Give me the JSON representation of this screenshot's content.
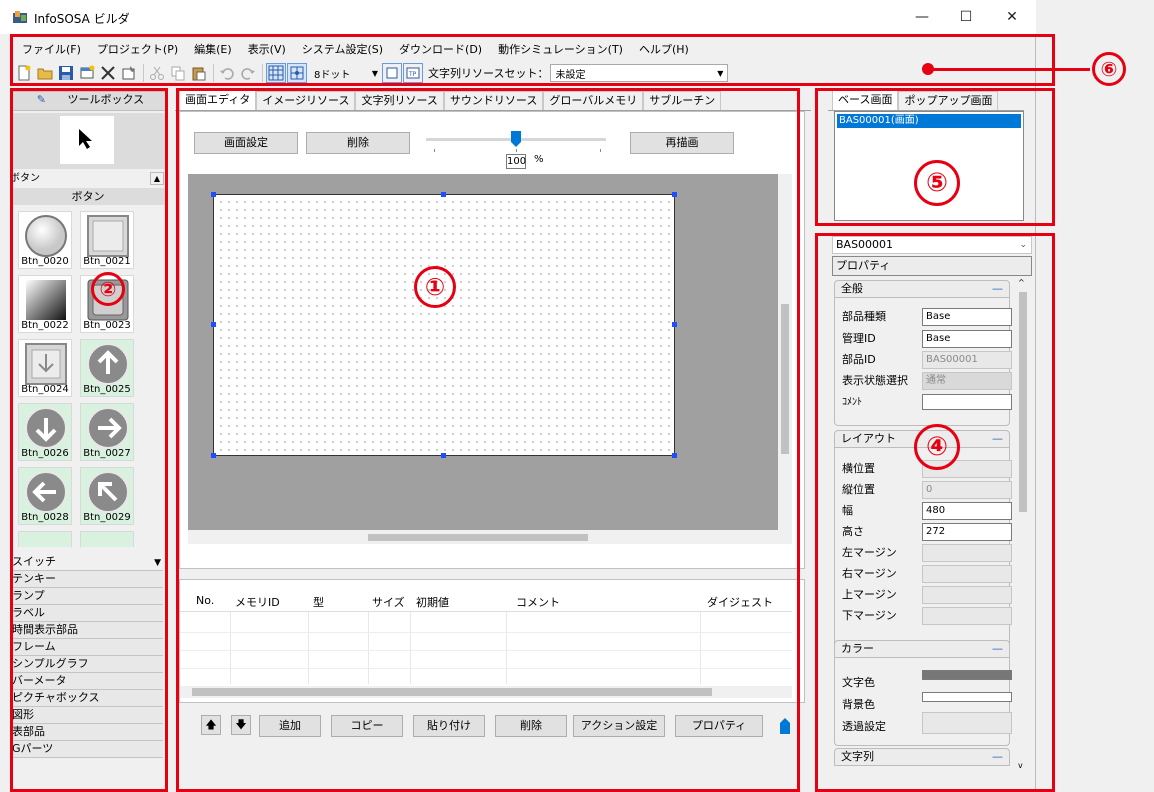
{
  "window": {
    "title": "InfoSOSA ビルダ",
    "minimize": "—",
    "maximize": "☐",
    "close": "✕"
  },
  "menu": [
    "ファイル(F)",
    "プロジェクト(P)",
    "編集(E)",
    "表示(V)",
    "システム設定(S)",
    "ダウンロード(D)",
    "動作シミュレーション(T)",
    "ヘルプ(H)"
  ],
  "toolbar": {
    "grid_select": "8ドット",
    "resource_label": "文字列リソースセット：",
    "resource_value": "未設定"
  },
  "toolbox": {
    "title": "ツールボックス",
    "group": "ボタン",
    "group_header": "ボタン",
    "buttons": [
      "Btn_0020",
      "Btn_0021",
      "Btn_0022",
      "Btn_0023",
      "Btn_0024",
      "Btn_0025",
      "Btn_0026",
      "Btn_0027",
      "Btn_0028",
      "Btn_0029"
    ],
    "categories": [
      "スイッチ",
      "テンキー",
      "ランプ",
      "ラベル",
      "時間表示部品",
      "フレーム",
      "シンプルグラフ",
      "バーメータ",
      "ピクチャボックス",
      "図形",
      "表部品",
      "Gパーツ"
    ]
  },
  "editor": {
    "tabs": [
      "画面エディタ",
      "イメージリソース",
      "文字列リソース",
      "サウンドリソース",
      "グローバルメモリ",
      "サブルーチン"
    ],
    "btn_screen_settings": "画面設定",
    "btn_delete": "削除",
    "btn_redraw": "再描画",
    "zoom_value": "100",
    "zoom_unit": "%",
    "zoom_fraction": 0.5
  },
  "memory": {
    "columns": [
      "No.",
      "メモリID",
      "型",
      "サイズ",
      "初期値",
      "コメント",
      "ダイジェスト"
    ],
    "buttons": [
      "追加",
      "コピー",
      "貼り付け",
      "削除",
      "アクション設定",
      "プロパティ"
    ]
  },
  "screens": {
    "tabs": [
      "ベース画面",
      "ポップアップ画面"
    ],
    "items": [
      "BAS00001(画面)"
    ]
  },
  "properties": {
    "selector": "BAS00001",
    "header": "プロパティ",
    "general": {
      "title": "全般",
      "part_type_label": "部品種類",
      "part_type": "Base",
      "manage_id_label": "管理ID",
      "manage_id": "Base",
      "part_id_label": "部品ID",
      "part_id": "BAS00001",
      "display_state_label": "表示状態選択",
      "display_state": "通常",
      "comment_label": "ｺﾒﾝﾄ"
    },
    "layout": {
      "title": "レイアウト",
      "x_label": "横位置",
      "y_label": "縦位置",
      "y_value": "0",
      "width_label": "幅",
      "width": "480",
      "height_label": "高さ",
      "height": "272",
      "left_margin": "左マージン",
      "right_margin": "右マージン",
      "top_margin": "上マージン",
      "bottom_margin": "下マージン"
    },
    "color": {
      "title": "カラー",
      "text_color": "文字色",
      "bg_color": "背景色",
      "transparency": "透過設定"
    },
    "string": {
      "title": "文字列"
    }
  },
  "annotations": [
    "①",
    "②",
    "④",
    "⑤",
    "⑥"
  ],
  "colors": {
    "accent": "#e60012",
    "selection": "#0078d7",
    "canvas_bg": "#a0a0a0"
  }
}
